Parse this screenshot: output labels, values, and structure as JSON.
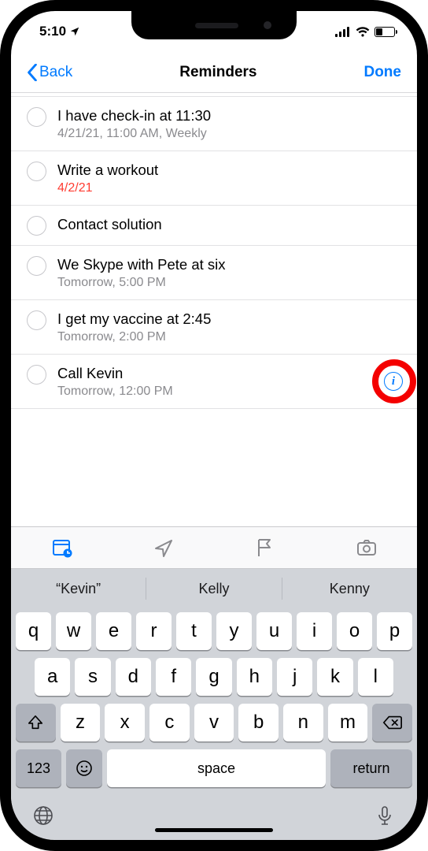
{
  "status": {
    "time": "5:10",
    "location_active": true
  },
  "nav": {
    "back": "Back",
    "title": "Reminders",
    "done": "Done"
  },
  "reminders": [
    {
      "title": "I have check-in at 11:30",
      "subtitle": "4/21/21, 11:00 AM, Weekly",
      "overdue": false
    },
    {
      "title": "Write a workout",
      "subtitle": "4/2/21",
      "overdue": true
    },
    {
      "title": "Contact solution",
      "subtitle": "",
      "overdue": false
    },
    {
      "title": "We Skype with Pete at six",
      "subtitle": "Tomorrow, 5:00 PM",
      "overdue": false
    },
    {
      "title": "I get my vaccine at 2:45",
      "subtitle": "Tomorrow, 2:00 PM",
      "overdue": false
    },
    {
      "title": "Call Kevin",
      "subtitle": "Tomorrow, 12:00 PM",
      "overdue": false
    }
  ],
  "predictions": [
    "“Kevin”",
    "Kelly",
    "Kenny"
  ],
  "keyboard": {
    "rows": [
      [
        "q",
        "w",
        "e",
        "r",
        "t",
        "y",
        "u",
        "i",
        "o",
        "p"
      ],
      [
        "a",
        "s",
        "d",
        "f",
        "g",
        "h",
        "j",
        "k",
        "l"
      ],
      [
        "z",
        "x",
        "c",
        "v",
        "b",
        "n",
        "m"
      ]
    ],
    "num": "123",
    "space": "space",
    "return": "return"
  }
}
